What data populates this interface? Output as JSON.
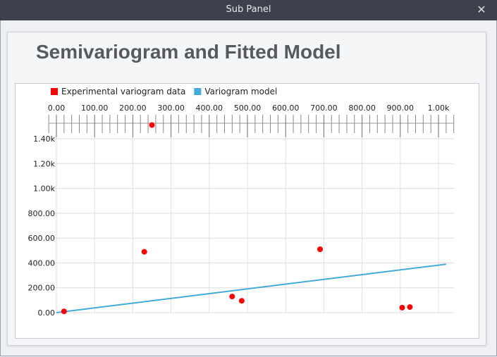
{
  "window": {
    "title": "Sub Panel",
    "close_icon": "close-icon"
  },
  "page": {
    "heading": "Semivariogram and Fitted Model"
  },
  "legend": [
    {
      "label": "Experimental variogram data",
      "color": "#ff0000"
    },
    {
      "label": "Variogram model",
      "color": "#45aad8"
    }
  ],
  "chart_data": {
    "type": "scatter",
    "title": "Semivariogram and Fitted Model",
    "x_ticks": [
      "0.00",
      "100.00",
      "200.00",
      "300.00",
      "400.00",
      "500.00",
      "600.00",
      "700.00",
      "800.00",
      "900.00",
      "1.00k"
    ],
    "y_ticks": [
      "0.00",
      "200.00",
      "400.00",
      "600.00",
      "800.00",
      "1.00k",
      "1.20k",
      "1.40k"
    ],
    "xlim": [
      0,
      1040
    ],
    "ylim": [
      0,
      1500
    ],
    "x_axis_position": "top",
    "grid": true,
    "legend_position": "top-left",
    "series": [
      {
        "name": "Experimental variogram data",
        "type": "scatter",
        "color": "#ff0000",
        "points": [
          {
            "x": 20,
            "y": 10
          },
          {
            "x": 230,
            "y": 490
          },
          {
            "x": 250,
            "y": 1510
          },
          {
            "x": 460,
            "y": 130
          },
          {
            "x": 485,
            "y": 95
          },
          {
            "x": 690,
            "y": 510
          },
          {
            "x": 905,
            "y": 40
          },
          {
            "x": 925,
            "y": 45
          }
        ]
      },
      {
        "name": "Variogram model",
        "type": "line",
        "color": "#45aad8",
        "points": [
          {
            "x": 0,
            "y": 0
          },
          {
            "x": 1020,
            "y": 390
          }
        ]
      }
    ]
  }
}
